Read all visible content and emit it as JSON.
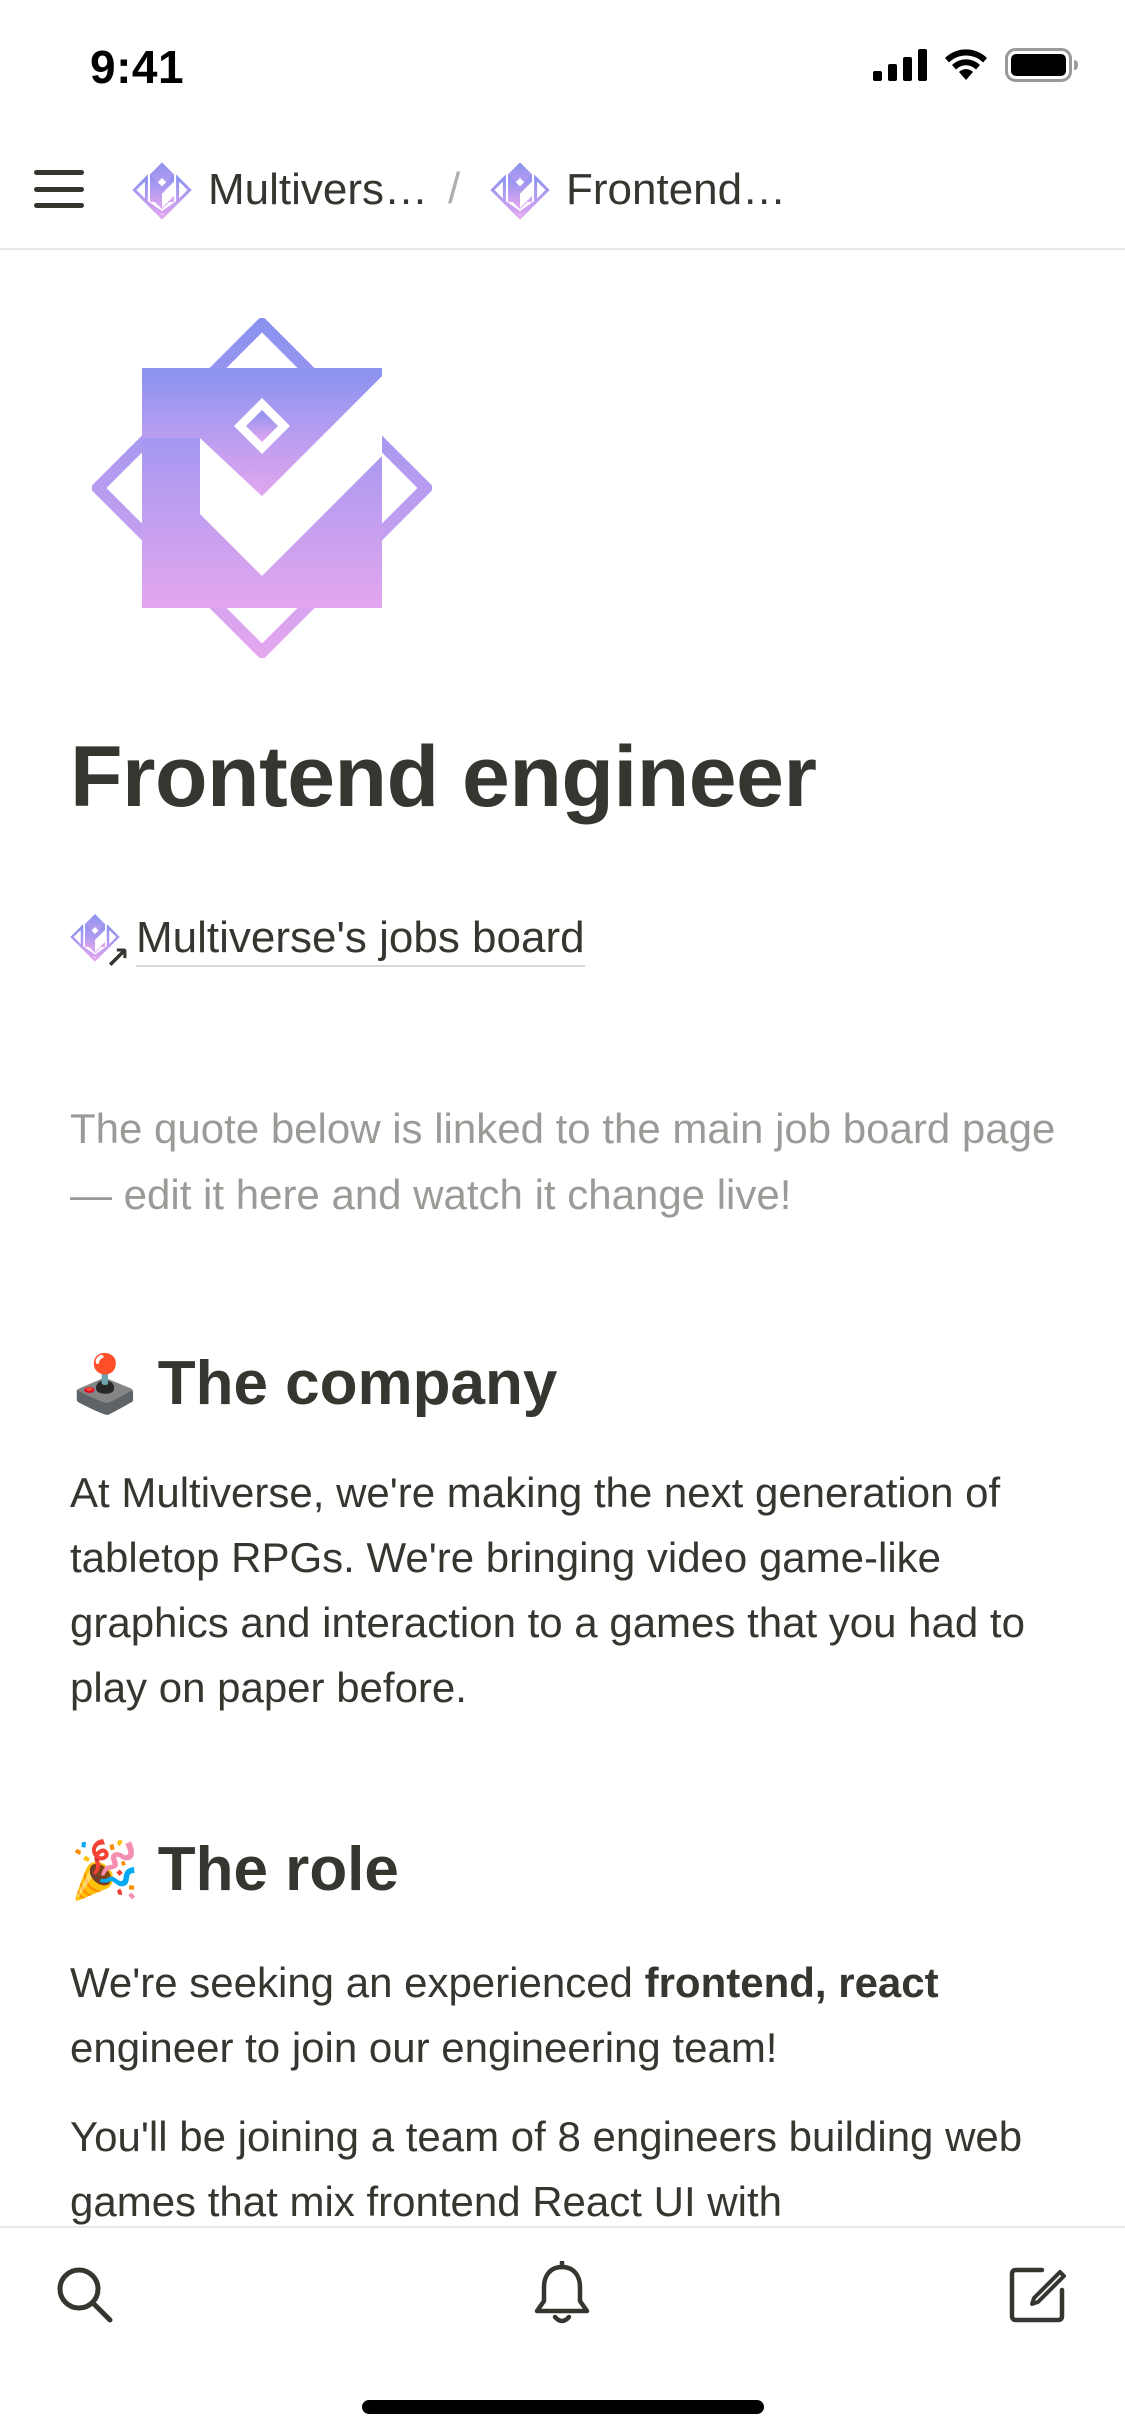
{
  "status_bar": {
    "time": "9:41"
  },
  "nav": {
    "breadcrumbs": [
      {
        "label": "Multivers…",
        "icon": "multiverse-logo-icon"
      },
      {
        "label": "Frontend…",
        "icon": "multiverse-logo-icon"
      }
    ],
    "separator": "/"
  },
  "page": {
    "title": "Frontend engineer",
    "link_label": "Multiverse's jobs board",
    "hint": "The quote below is linked to the main job board page — edit it here and watch it change live!",
    "sections": [
      {
        "emoji": "🕹️",
        "heading": "The company",
        "paragraphs": [
          "At Multiverse, we're making the next generation of tabletop RPGs. We're bringing video game-like graphics and interaction to a games that you had to play on paper before."
        ]
      },
      {
        "emoji": "🎉",
        "heading": "The role",
        "paragraphs": [
          {
            "before": "We're seeking an experienced ",
            "bold": "frontend, react",
            "after": " engineer to join our engineering team!"
          },
          "You'll be joining a team of 8 engineers building web games that mix frontend React UI with"
        ]
      }
    ]
  },
  "toolbar": {
    "items": [
      {
        "name": "search",
        "icon": "search-icon"
      },
      {
        "name": "notifications",
        "icon": "bell-icon"
      },
      {
        "name": "new-page",
        "icon": "compose-icon"
      }
    ]
  },
  "colors": {
    "text": "#37352f",
    "muted": "#9b9a97",
    "logo_gradient_top": "#8b93f0",
    "logo_gradient_bottom": "#e2a3ee"
  }
}
